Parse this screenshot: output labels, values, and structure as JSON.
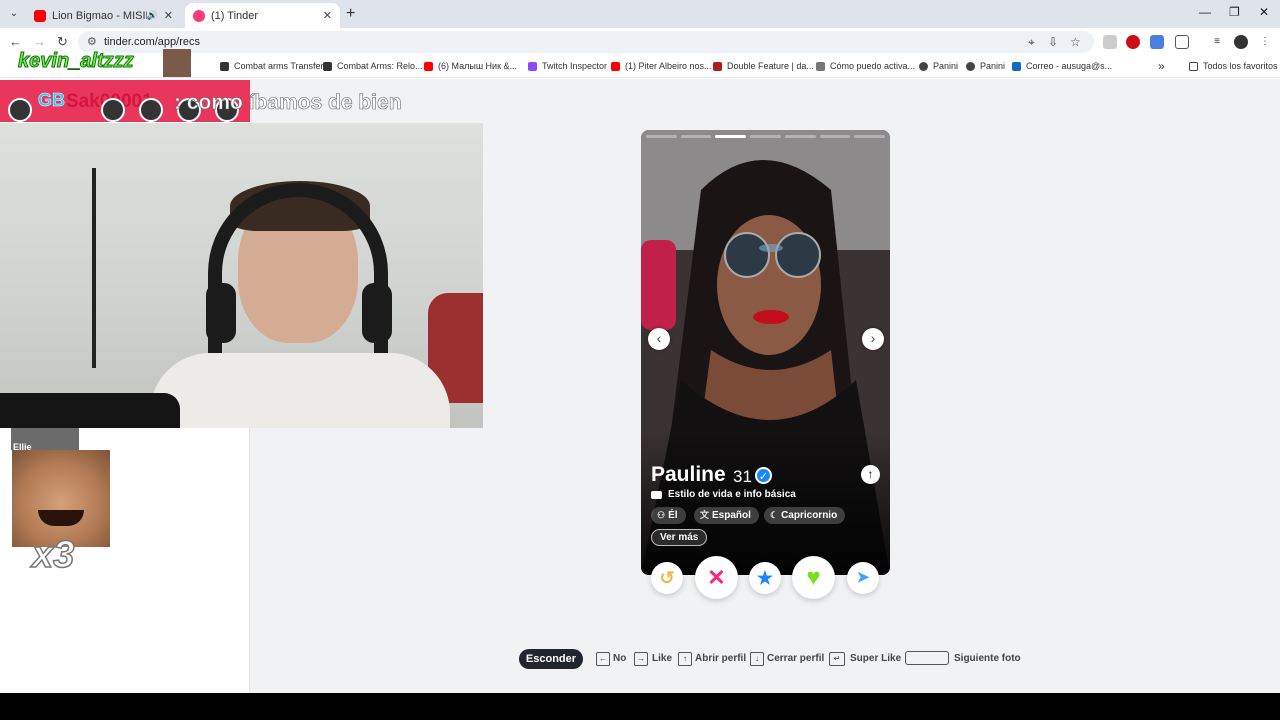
{
  "browser": {
    "tabs": [
      {
        "title": "Lion Bigmao - MISIL - YouTub",
        "favicon_color": "#ff0000",
        "active": false
      },
      {
        "title": "(1) Tinder",
        "favicon_color": "#fd3a73",
        "active": true
      }
    ],
    "url": "tinder.com/app/recs",
    "bookmarks": [
      {
        "label": "Combat arms Transfer"
      },
      {
        "label": "Combat Arms: Relo..."
      },
      {
        "label": "(6) Малыш Ник &..."
      },
      {
        "label": "Twitch Inspector"
      },
      {
        "label": "(1) Piter Albeiro nos..."
      },
      {
        "label": "Double Feature | da..."
      },
      {
        "label": "Cómo puedo activa..."
      },
      {
        "label": "Panini"
      },
      {
        "label": "Panini"
      },
      {
        "label": "Correo - ausuga@s..."
      }
    ],
    "bookmarks_overflow": "»",
    "all_bookmarks": "Todos los favoritos"
  },
  "stream": {
    "overlay_user": "kevin_altzzz",
    "chat_prefix": "GB",
    "chat_user": "Sak00001",
    "chat_message": ": como íbamos de bien",
    "small_label": "Ellie",
    "multiplier": "x3"
  },
  "profile": {
    "name": "Pauline",
    "age": "31",
    "section_title": "Estilo de vida e info básica",
    "chips": [
      {
        "icon": "person-icon",
        "glyph": "⚇",
        "label": "Él"
      },
      {
        "icon": "language-icon",
        "glyph": "文",
        "label": "Español"
      },
      {
        "icon": "zodiac-icon",
        "glyph": "☾",
        "label": "Capricornio"
      }
    ],
    "more_label": "Ver más",
    "photo_count": 7,
    "photo_index": 3
  },
  "actions": {
    "rewind_glyph": "↺",
    "nope_glyph": "✕",
    "superlike_glyph": "★",
    "like_glyph": "♥",
    "boost_glyph": "➤",
    "colors": {
      "rewind": "#f5b748",
      "nope": "#fd267d",
      "superlike": "#1786ff",
      "like": "#7bde1f",
      "boost": "#3ca4ff"
    }
  },
  "shortcuts": {
    "hide_label": "Esconder",
    "items": [
      {
        "key": "←",
        "label": "No"
      },
      {
        "key": "→",
        "label": "Like"
      },
      {
        "key": "↑",
        "label": "Abrir perfil"
      },
      {
        "key": "↓",
        "label": "Cerrar perfil"
      },
      {
        "key": "↵",
        "label": "Super Like"
      },
      {
        "key": "",
        "label": "Siguiente foto"
      }
    ]
  }
}
